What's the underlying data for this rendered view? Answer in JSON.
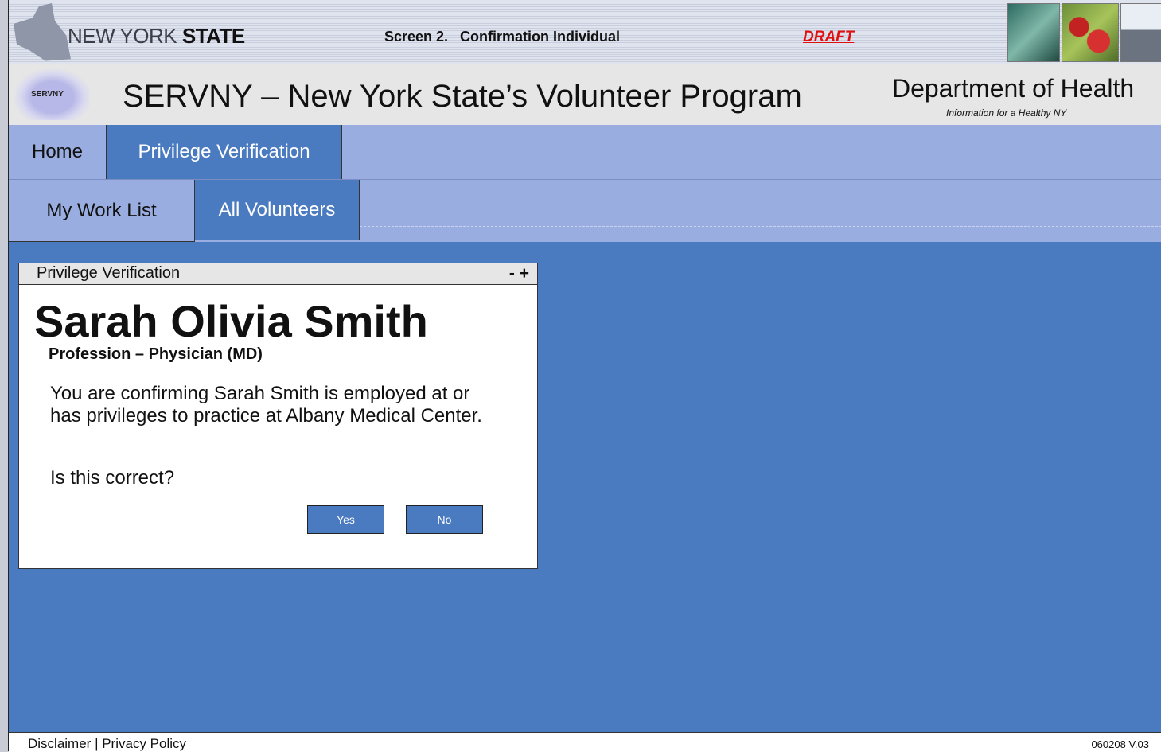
{
  "banner": {
    "state_prefix": "NEW YORK",
    "state_bold": "STATE",
    "screen_title": "Screen 2.   Confirmation Individual",
    "draft_label": "DRAFT"
  },
  "header": {
    "logo_text": "SERVNY",
    "app_title": "SERVNY – New York State’s Volunteer Program",
    "department": "Department of Health",
    "department_tagline": "Information for a Healthy NY"
  },
  "nav": {
    "primary_tabs": [
      {
        "label": "Home",
        "active": false
      },
      {
        "label": "Privilege Verification",
        "active": true
      }
    ],
    "secondary_tabs": [
      {
        "label": "My Work List",
        "active": false
      },
      {
        "label": "All Volunteers",
        "active": true
      }
    ]
  },
  "panel": {
    "title": "Privilege Verification",
    "controls": "- +",
    "volunteer_name": "Sarah Olivia Smith",
    "profession": "Profession – Physician (MD)",
    "message": "You are confirming Sarah Smith is employed at or has privileges to practice at Albany Medical Center.",
    "question": "Is this correct?",
    "yes_label": "Yes",
    "no_label": "No"
  },
  "footer": {
    "disclaimer": "Disclaimer",
    "separator": " | ",
    "privacy": "Privacy Policy",
    "version": "060208 V.03"
  },
  "colors": {
    "content_bg": "#4a7abf",
    "nav_bg": "#99ade0",
    "draft": "#e01010"
  }
}
